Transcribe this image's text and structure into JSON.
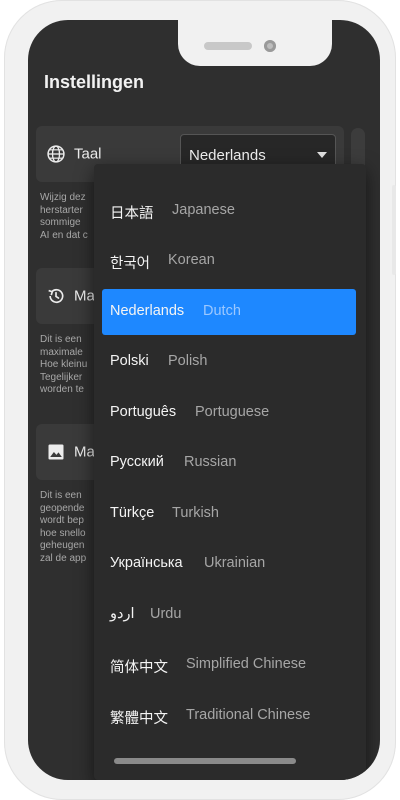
{
  "header": {
    "title": "Instellingen"
  },
  "settings": {
    "language": {
      "label": "Taal",
      "selected": "Nederlands",
      "description": "Wijzig dez\nherstarter\nsommige\nAI en dat c"
    },
    "history": {
      "label": "Ma",
      "description": "Dit is een\nmaximale\nHoe kleinu\nTegelijker\nworden te"
    },
    "media": {
      "label": "Ma",
      "description": "Dit is een\ngeopende\nwordt bep\nhoe snello\ngeheugen\nzal de app"
    }
  },
  "dropdown": {
    "options": [
      {
        "native": "日本語",
        "english": "Japanese"
      },
      {
        "native": "한국어",
        "english": "Korean"
      },
      {
        "native": "Nederlands",
        "english": "Dutch",
        "selected": true
      },
      {
        "native": "Polski",
        "english": "Polish"
      },
      {
        "native": "Português",
        "english": "Portuguese"
      },
      {
        "native": "Русский",
        "english": "Russian"
      },
      {
        "native": "Türkçe",
        "english": "Turkish"
      },
      {
        "native": "Українська",
        "english": "Ukrainian"
      },
      {
        "native": "اردو",
        "english": "Urdu"
      },
      {
        "native": "简体中文",
        "english": "Simplified Chinese"
      },
      {
        "native": "繁體中文",
        "english": "Traditional Chinese"
      }
    ]
  },
  "colors": {
    "background": "#2f2f2f",
    "accent": "#1e88ff",
    "text": "#f2f2f2"
  }
}
